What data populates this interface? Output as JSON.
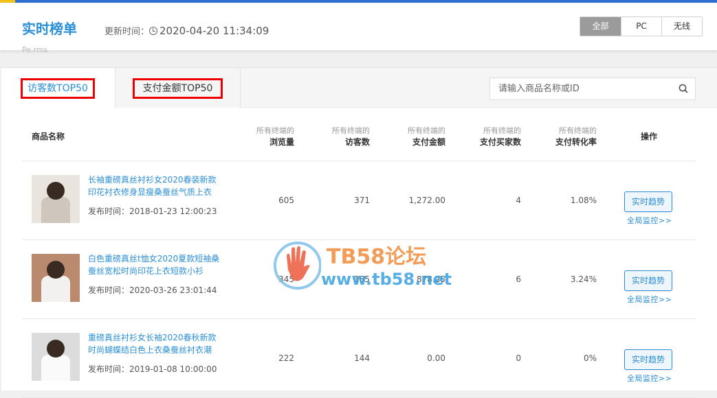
{
  "header": {
    "title": "实时榜单",
    "update_label": "更新时间：",
    "update_time": "2020-04-20 11:34:09",
    "ghost_text": "Pe rms",
    "segments": [
      "全部",
      "PC",
      "无线"
    ]
  },
  "tabs": [
    {
      "label": "访客数TOP50"
    },
    {
      "label": "支付金额TOP50"
    }
  ],
  "search": {
    "placeholder": "请输入商品名称或ID"
  },
  "columns": {
    "name": "商品名称",
    "prefix": "所有终端的",
    "views": "浏览量",
    "visitors": "访客数",
    "amount": "支付金额",
    "buyers": "支付买家数",
    "conversion": "支付转化率",
    "action": "操作"
  },
  "rows": [
    {
      "name": "长袖重磅真丝衬衫女2020春装新款印花衬衣修身显瘦桑蚕丝气质上衣",
      "date": "发布时间：2018-01-23 12:00:23",
      "views": "605",
      "visitors": "371",
      "amount": "1,272.00",
      "buyers": "4",
      "conversion": "1.08%",
      "thumb_color": "#e9e4de",
      "body_color": "#cfc6bd"
    },
    {
      "name": "白色重磅真丝t恤女2020夏款短袖桑蚕丝宽松时尚印花上衣短款小衫",
      "date": "发布时间：2020-03-26 23:01:44",
      "views": "345",
      "visitors": "185",
      "amount": "878.25",
      "buyers": "6",
      "conversion": "3.24%",
      "thumb_color": "#b98a6e",
      "body_color": "#f3f1ef"
    },
    {
      "name": "重磅真丝衬衫女长袖2020春秋新款时尚蝴蝶结白色上衣桑蚕丝衬衣潮",
      "date": "发布时间：2019-01-08 10:00:00",
      "views": "222",
      "visitors": "144",
      "amount": "0.00",
      "buyers": "0",
      "conversion": "0%",
      "thumb_color": "#dcdcdc",
      "body_color": "#fafafa"
    }
  ],
  "actions": {
    "trend": "实时趋势",
    "monitor": "全局监控>>"
  },
  "watermark": {
    "line1": "TB58论坛",
    "line2": "www.tb58.net"
  }
}
